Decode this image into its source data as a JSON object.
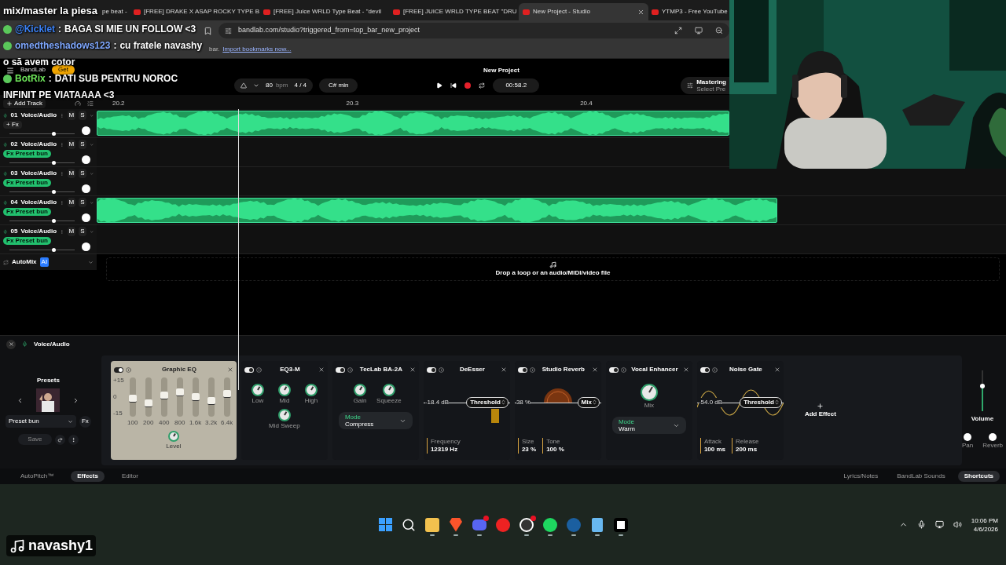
{
  "browser": {
    "tabs": [
      {
        "title": "pe beat -",
        "selected": false
      },
      {
        "title": "[FREE] DRAKE X ASAP ROCKY TYPE B",
        "selected": false
      },
      {
        "title": "[FREE] Juice WRLD Type Beat - \"devil",
        "selected": false
      },
      {
        "title": "[FREE] JUICE WRLD TYPE BEAT \"DRU",
        "selected": false
      },
      {
        "title": "New Project - Studio",
        "selected": true
      },
      {
        "title": "YTMP3 - Free YouTube",
        "selected": false
      }
    ],
    "url": "bandlab.com/studio?triggered_from=top_bar_new_project",
    "bookmarks_hint": "bar.",
    "bookmarks_link": "Import bookmarks now..."
  },
  "app": {
    "logo": "BandLab",
    "get_button": "Get",
    "project_title": "New Project",
    "transport": {
      "bpm": "80",
      "bpm_unit": "bpm",
      "time_signature": "4 / 4",
      "key": "C# min",
      "time": "00:58.2",
      "mastering": "Mastering",
      "mastering_preset": "Select Pre"
    },
    "add_track": "Add Track",
    "ruler": [
      "20.2",
      "20.3",
      "20.4"
    ],
    "tracks": [
      {
        "number": "01",
        "name": "Voice/Audio",
        "mute": "M",
        "solo": "S",
        "fx": {
          "kind": "add",
          "label": "+ Fx"
        },
        "level": 0.68,
        "clip": true
      },
      {
        "number": "02",
        "name": "Voice/Audio",
        "mute": "M",
        "solo": "S",
        "fx": {
          "kind": "preset",
          "label": "Fx Preset bun"
        },
        "level": 0.68,
        "clip": false
      },
      {
        "number": "03",
        "name": "Voice/Audio",
        "mute": "M",
        "solo": "S",
        "fx": {
          "kind": "preset",
          "label": "Fx Preset bun"
        },
        "level": 0.68,
        "clip": false
      },
      {
        "number": "04",
        "name": "Voice/Audio",
        "mute": "M",
        "solo": "S",
        "fx": {
          "kind": "preset",
          "label": "Fx Preset bun"
        },
        "level": 0.68,
        "clip": true
      },
      {
        "number": "05",
        "name": "Voice/Audio",
        "mute": "M",
        "solo": "S",
        "fx": {
          "kind": "preset",
          "label": "Fx Preset bun"
        },
        "level": 0.68,
        "clip": false
      }
    ],
    "automix": {
      "label": "AutoMix",
      "badge": "AI"
    },
    "drop_hint": "Drop a loop or an audio/MIDI/video file"
  },
  "effects_panel": {
    "track_name": "Voice/Audio",
    "presets_title": "Presets",
    "preset": "Preset bun",
    "fx_button": "Fx",
    "save": "Save",
    "effects": [
      {
        "kind": "graphic_eq",
        "name": "Graphic EQ",
        "enabled": true,
        "selected": true,
        "scale": [
          "+15",
          "0",
          "-15"
        ],
        "bands": [
          {
            "label": "100",
            "level": 0.45
          },
          {
            "label": "200",
            "level": 0.3
          },
          {
            "label": "400",
            "level": 0.55
          },
          {
            "label": "800",
            "level": 0.65
          },
          {
            "label": "1.6k",
            "level": 0.5
          },
          {
            "label": "3.2k",
            "level": 0.38
          },
          {
            "label": "6.4k",
            "level": 0.6
          }
        ],
        "knob_label": "Level"
      },
      {
        "kind": "knobs",
        "name": "EQ3-M",
        "enabled": true,
        "selected": false,
        "knobs": [
          "Low",
          "Mid",
          "High",
          "Mid Sweep"
        ]
      },
      {
        "kind": "knobs",
        "name": "TecLab BA-2A",
        "enabled": true,
        "selected": false,
        "knobs": [
          "Gain",
          "Squeeze"
        ],
        "mode": {
          "label": "Mode",
          "value": "Compress"
        }
      },
      {
        "kind": "deesser",
        "name": "DeEsser",
        "enabled": true,
        "selected": false,
        "reading": "-18.4 dB",
        "control": "Threshold",
        "params": [
          {
            "label": "Frequency",
            "value": "12319 Hz"
          }
        ]
      },
      {
        "kind": "reverb",
        "name": "Studio Reverb",
        "enabled": true,
        "selected": false,
        "reading": "38 %",
        "control": "Mix",
        "params": [
          {
            "label": "Size",
            "value": "23 %"
          },
          {
            "label": "Tone",
            "value": "100 %"
          }
        ]
      },
      {
        "kind": "knobs",
        "name": "Vocal Enhancer",
        "enabled": true,
        "selected": false,
        "knobs": [
          "Mix"
        ],
        "mode": {
          "label": "Mode",
          "value": "Warm"
        }
      },
      {
        "kind": "gate",
        "name": "Noise Gate",
        "enabled": true,
        "selected": false,
        "reading": "-54.0 dB",
        "control": "Threshold",
        "params": [
          {
            "label": "Attack",
            "value": "100 ms"
          },
          {
            "label": "Release",
            "value": "200 ms"
          }
        ]
      }
    ],
    "add_effect": "Add Effect",
    "volume": {
      "label": "Volume",
      "level": 0.62
    },
    "pan": "Pan",
    "reverb": "Reverb"
  },
  "bottom_tabs": [
    {
      "label": "AutoPitch™",
      "selected": false
    },
    {
      "label": "Effects",
      "selected": true
    },
    {
      "label": "Editor",
      "selected": false
    }
  ],
  "bottom_links": [
    {
      "label": "Lyrics/Notes",
      "kind": "plain"
    },
    {
      "label": "BandLab Sounds",
      "kind": "plain"
    },
    {
      "label": "Shortcuts",
      "kind": "pill"
    }
  ],
  "overlay": {
    "title": "mix/master la piesa",
    "chat": [
      {
        "user": "@Kicklet",
        "color": "#3b82f6",
        "separator": ":",
        "lines": [
          "BAGA SI MIE UN FOLLOW <3"
        ]
      },
      {
        "user": "omedtheshadows123",
        "color": "#7fa8ff",
        "separator": ":",
        "lines": [
          "cu fratele navashy",
          "o să avem cotor"
        ]
      },
      {
        "user": "BotRix",
        "color": "#6ee65a",
        "separator": ":",
        "lines": [
          "DATI SUB PENTRU NOROC",
          "INFINIT PE VIATAAAA <3"
        ]
      }
    ],
    "tiktok_user": "navashy1"
  },
  "taskbar": {
    "apps": [
      {
        "kind": "windows",
        "running": false,
        "badge": false
      },
      {
        "kind": "search",
        "running": false,
        "badge": false
      },
      {
        "kind": "folder",
        "running": true,
        "badge": false
      },
      {
        "kind": "brave",
        "running": true,
        "badge": false
      },
      {
        "kind": "discord",
        "running": true,
        "badge": true
      },
      {
        "kind": "youtube",
        "running": false,
        "badge": false
      },
      {
        "kind": "obs",
        "running": true,
        "badge": true
      },
      {
        "kind": "spotify",
        "running": true,
        "badge": false
      },
      {
        "kind": "steam",
        "running": true,
        "badge": false
      },
      {
        "kind": "notepad",
        "running": true,
        "badge": false
      },
      {
        "kind": "capcut",
        "running": true,
        "badge": false
      }
    ],
    "time": "10:06 PM",
    "date": "4/6/2026"
  }
}
